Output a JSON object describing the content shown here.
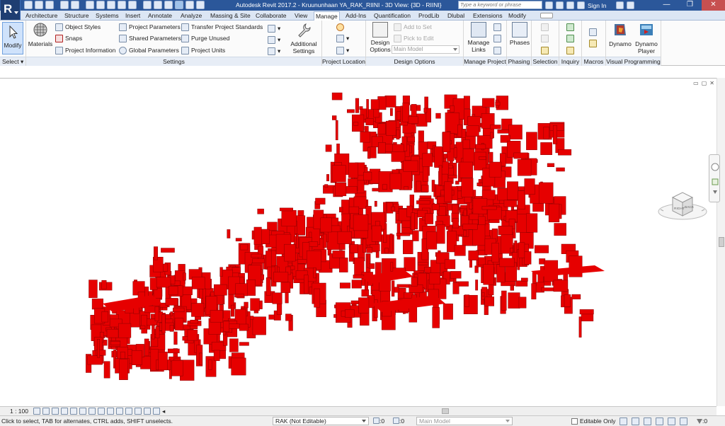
{
  "app": {
    "title": "Autodesk Revit 2017.2 -     Kruununhaan YA_RAK_RIINI - 3D View: {3D - RIINI}",
    "logo_letter": "R",
    "search_placeholder": "Type a keyword or phrase",
    "sign_in": "Sign In",
    "help": "?"
  },
  "window_controls": {
    "minimize": "—",
    "restore": "❐",
    "close": "✕"
  },
  "tabs": [
    {
      "label": "Architecture",
      "active": false
    },
    {
      "label": "Structure",
      "active": false
    },
    {
      "label": "Systems",
      "active": false
    },
    {
      "label": "Insert",
      "active": false
    },
    {
      "label": "Annotate",
      "active": false
    },
    {
      "label": "Analyze",
      "active": false
    },
    {
      "label": "Massing & Site",
      "active": false
    },
    {
      "label": "Collaborate",
      "active": false
    },
    {
      "label": "View",
      "active": false
    },
    {
      "label": "Manage",
      "active": true
    },
    {
      "label": "Add-Ins",
      "active": false
    },
    {
      "label": "Quantification",
      "active": false
    },
    {
      "label": "ProdLib",
      "active": false
    },
    {
      "label": "Dlubal",
      "active": false
    },
    {
      "label": "Extensions",
      "active": false
    },
    {
      "label": "Modify",
      "active": false
    }
  ],
  "ribbon": {
    "select": {
      "button": "Modify",
      "panel": "Select ▾"
    },
    "settings": {
      "panel": "Settings",
      "materials": "Materials",
      "object_styles": "Object  Styles",
      "snaps": "Snaps",
      "project_information": "Project  Information",
      "project_parameters": "Project  Parameters",
      "shared_parameters": "Shared  Parameters",
      "global_parameters": "Global  Parameters",
      "transfer_project_standards": "Transfer  Project Standards",
      "purge_unused": "Purge  Unused",
      "project_units": "Project  Units",
      "additional_settings_line1": "Additional",
      "additional_settings_line2": "Settings"
    },
    "project_location": {
      "panel": "Project Location"
    },
    "design_options": {
      "panel": "Design Options",
      "button_line1": "Design",
      "button_line2": "Options",
      "add_to_set": "Add to Set",
      "pick_to_edit": "Pick to Edit",
      "main_model": "Main Model"
    },
    "manage_project": {
      "panel": "Manage Project",
      "manage_links_line1": "Manage",
      "manage_links_line2": "Links"
    },
    "phasing": {
      "panel": "Phasing",
      "phases": "Phases"
    },
    "selection": {
      "panel": "Selection"
    },
    "inquiry": {
      "panel": "Inquiry"
    },
    "macros": {
      "panel": "Macros"
    },
    "visual_programming": {
      "panel": "Visual Programming",
      "dynamo": "Dynamo",
      "dynamo_player_line1": "Dynamo",
      "dynamo_player_line2": "Player"
    }
  },
  "viewcube": {
    "left_face": "RIGHT",
    "right_face": "BACK"
  },
  "view_control_bar": {
    "scale": "1 : 100"
  },
  "status_bar": {
    "message": "Click to select, TAB for alternates, CTRL adds, SHIFT unselects.",
    "workset": "RAK (Not Editable)",
    "count_a": ":0",
    "count_b": ":0",
    "design_option": "Main Model",
    "editable_only": "Editable Only",
    "filter_count": ":0"
  },
  "colors": {
    "model_red": "#e60000",
    "title_blue": "#2b579a",
    "tab_bar": "#dce6f4",
    "panel_label_bar": "#e7edf6"
  }
}
